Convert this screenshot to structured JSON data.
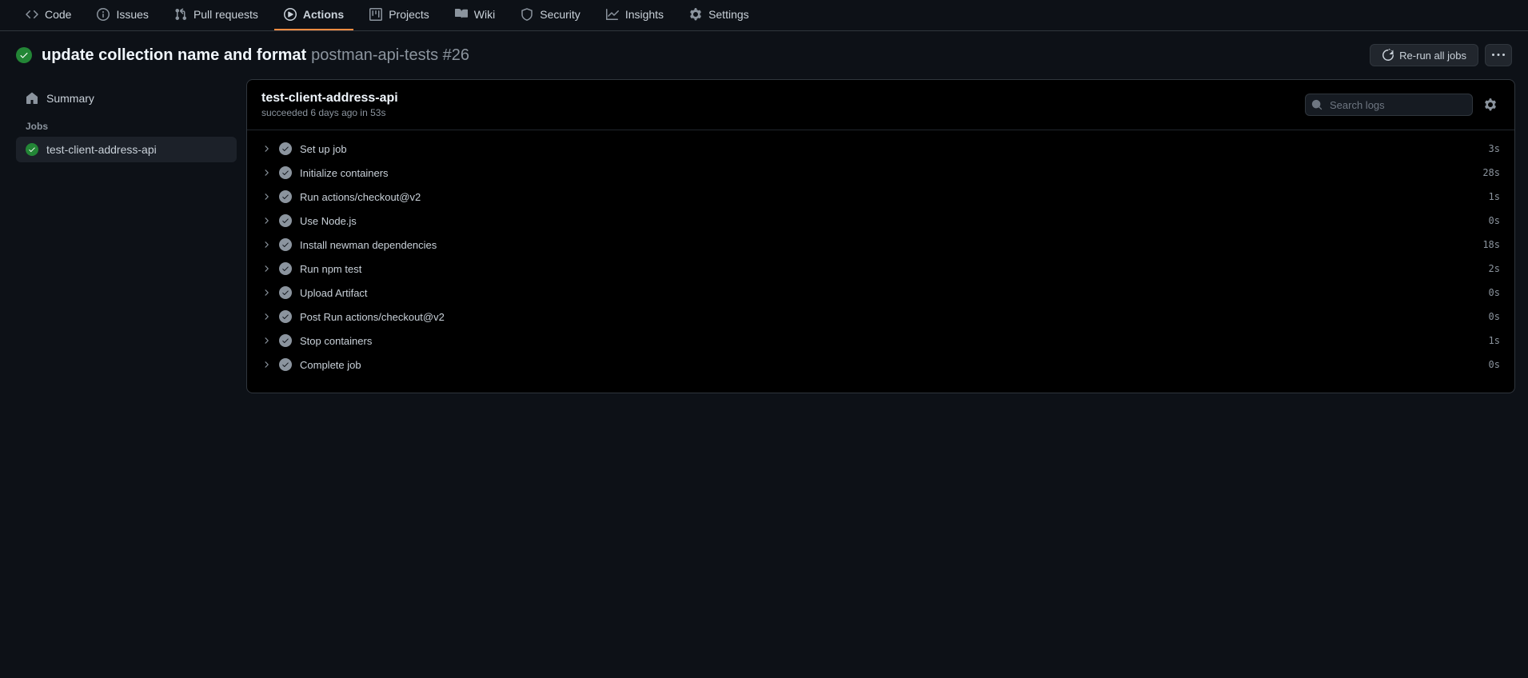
{
  "nav": {
    "tabs": [
      {
        "label": "Code",
        "icon": "code-icon"
      },
      {
        "label": "Issues",
        "icon": "issue-icon"
      },
      {
        "label": "Pull requests",
        "icon": "pr-icon"
      },
      {
        "label": "Actions",
        "icon": "play-icon",
        "active": true
      },
      {
        "label": "Projects",
        "icon": "project-icon"
      },
      {
        "label": "Wiki",
        "icon": "book-icon"
      },
      {
        "label": "Security",
        "icon": "shield-icon"
      },
      {
        "label": "Insights",
        "icon": "graph-icon"
      },
      {
        "label": "Settings",
        "icon": "gear-icon"
      }
    ]
  },
  "header": {
    "title": "update collection name and format",
    "subtitle": "postman-api-tests #26",
    "rerun_label": "Re-run all jobs"
  },
  "sidebar": {
    "summary_label": "Summary",
    "jobs_heading": "Jobs",
    "jobs": [
      {
        "label": "test-client-address-api"
      }
    ]
  },
  "log": {
    "title": "test-client-address-api",
    "subtitle": "succeeded 6 days ago in 53s",
    "search_placeholder": "Search logs",
    "steps": [
      {
        "name": "Set up job",
        "time": "3s"
      },
      {
        "name": "Initialize containers",
        "time": "28s"
      },
      {
        "name": "Run actions/checkout@v2",
        "time": "1s"
      },
      {
        "name": "Use Node.js",
        "time": "0s"
      },
      {
        "name": "Install newman dependencies",
        "time": "18s"
      },
      {
        "name": "Run npm test",
        "time": "2s"
      },
      {
        "name": "Upload Artifact",
        "time": "0s"
      },
      {
        "name": "Post Run actions/checkout@v2",
        "time": "0s"
      },
      {
        "name": "Stop containers",
        "time": "1s"
      },
      {
        "name": "Complete job",
        "time": "0s"
      }
    ]
  }
}
